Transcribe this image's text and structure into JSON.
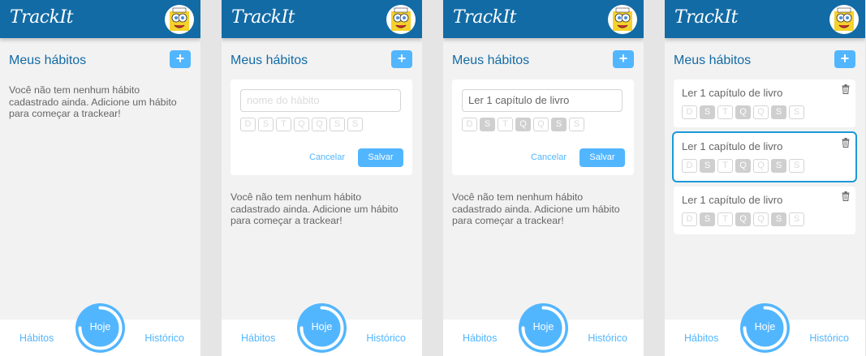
{
  "app": {
    "logo": "TrackIt",
    "section_title": "Meus hábitos",
    "add_label": "+",
    "empty_message": "Você não tem nenhum hábito cadastrado ainda. Adicione um hábito para começar a trackear!"
  },
  "form": {
    "placeholder": "nome do hábito",
    "value": "Ler 1 capítulo de livro",
    "cancel_label": "Cancelar",
    "save_label": "Salvar"
  },
  "weekdays": [
    "D",
    "S",
    "T",
    "Q",
    "Q",
    "S",
    "S"
  ],
  "habit": {
    "name": "Ler 1 capítulo de livro",
    "selected_days": [
      1,
      3,
      5
    ]
  },
  "nav": {
    "habits_label": "Hábitos",
    "today_label": "Hoje",
    "history_label": "Histórico",
    "today_progress": 0.75
  },
  "icons": {
    "add": "plus-icon",
    "delete": "trash-icon",
    "avatar": "spongebob-avatar"
  },
  "colors": {
    "header": "#126BA5",
    "accent": "#52B6FF",
    "background": "#F2F2F2",
    "highlight": "#1B9AD8"
  }
}
